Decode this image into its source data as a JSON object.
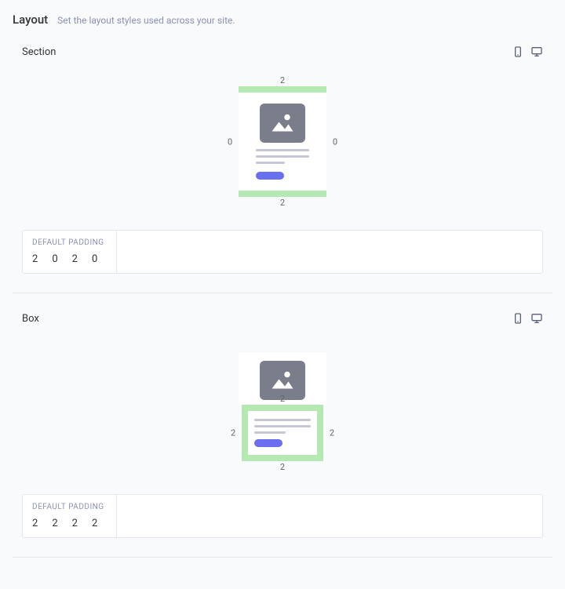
{
  "header": {
    "title": "Layout",
    "subtitle": "Set the layout styles used across your site."
  },
  "section": {
    "title": "Section",
    "pad_top": "2",
    "pad_right": "0",
    "pad_bottom": "2",
    "pad_left": "0",
    "dp_label": "DEFAULT PADDING",
    "dp_values": {
      "v1": "2",
      "v2": "0",
      "v3": "2",
      "v4": "0"
    }
  },
  "box": {
    "title": "Box",
    "pad_top": "2",
    "pad_right": "2",
    "pad_bottom": "2",
    "pad_left": "2",
    "dp_label": "DEFAULT PADDING",
    "dp_values": {
      "v1": "2",
      "v2": "2",
      "v3": "2",
      "v4": "2"
    }
  }
}
